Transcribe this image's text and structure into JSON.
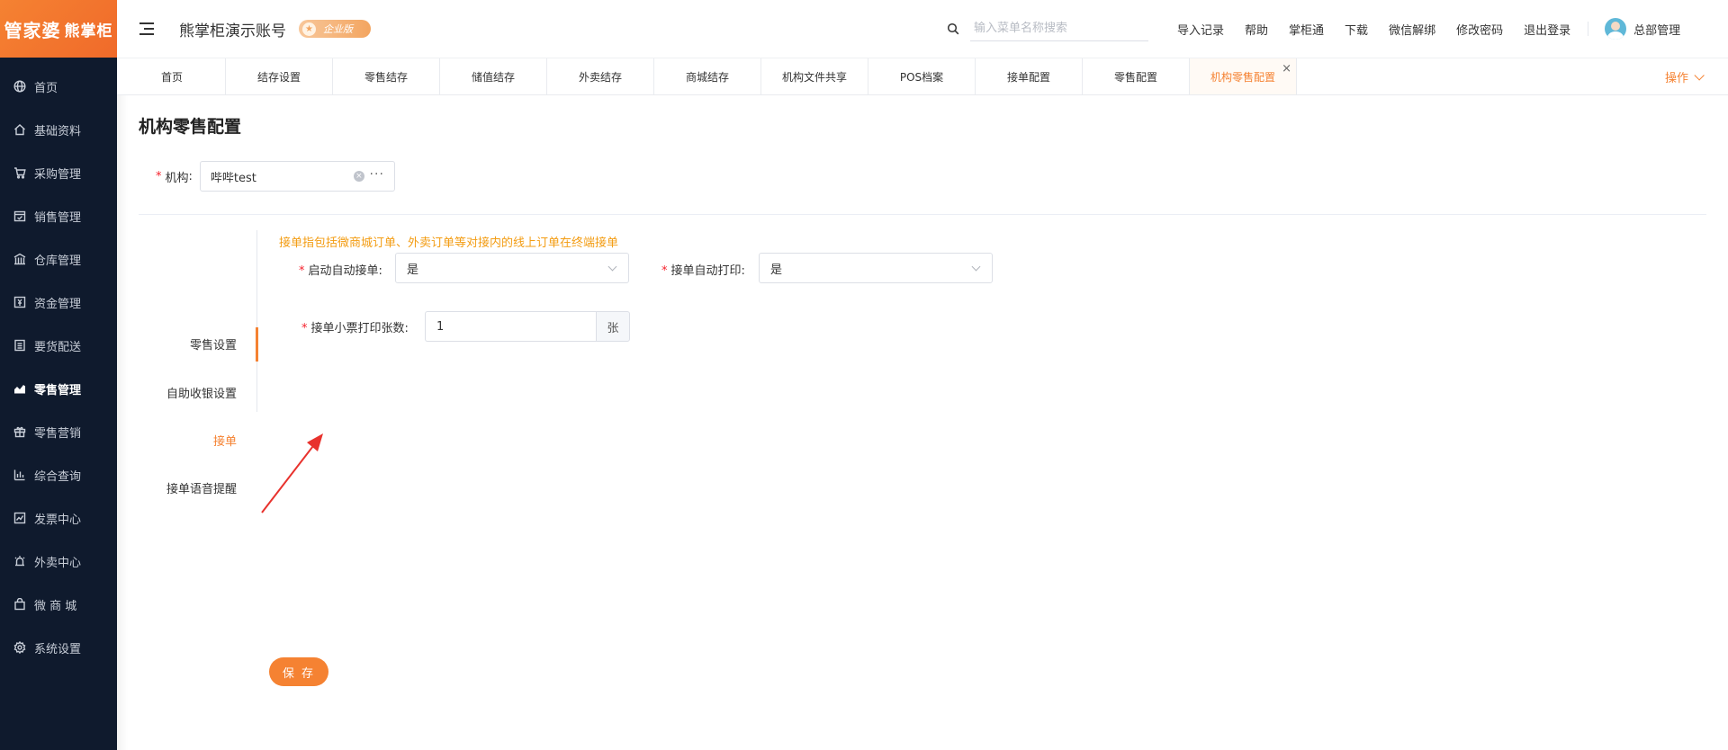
{
  "logo": {
    "part1": "管家婆",
    "part2": "熊掌柜"
  },
  "sidebar": {
    "items": [
      {
        "label": "首页",
        "icon": "globe-icon"
      },
      {
        "label": "基础资料",
        "icon": "home-icon"
      },
      {
        "label": "采购管理",
        "icon": "cart-icon"
      },
      {
        "label": "销售管理",
        "icon": "calendar-icon"
      },
      {
        "label": "仓库管理",
        "icon": "warehouse-icon"
      },
      {
        "label": "资金管理",
        "icon": "money-icon"
      },
      {
        "label": "要货配送",
        "icon": "list-icon"
      },
      {
        "label": "零售管理",
        "icon": "chart-icon",
        "active": true
      },
      {
        "label": "零售营销",
        "icon": "gift-icon"
      },
      {
        "label": "综合查询",
        "icon": "bar-chart-icon"
      },
      {
        "label": "发票中心",
        "icon": "trend-icon"
      },
      {
        "label": "外卖中心",
        "icon": "alarm-icon"
      },
      {
        "label": "微 商 城",
        "icon": "bag-icon"
      },
      {
        "label": "系统设置",
        "icon": "gear-icon"
      }
    ]
  },
  "header": {
    "account_name": "熊掌柜演示账号",
    "edition_badge": "企业版",
    "search_placeholder": "输入菜单名称搜索",
    "links": [
      "导入记录",
      "帮助",
      "掌柜通",
      "下载",
      "微信解绑",
      "修改密码",
      "退出登录"
    ],
    "user_name": "总部管理"
  },
  "tabs": {
    "items": [
      "首页",
      "结存设置",
      "零售结存",
      "储值结存",
      "外卖结存",
      "商城结存",
      "机构文件共享",
      "POS档案",
      "接单配置",
      "零售配置",
      "机构零售配置"
    ],
    "active_index": 10,
    "close_glyph": "×",
    "operations_label": "操作"
  },
  "page": {
    "title": "机构零售配置",
    "org_label": "机构",
    "org_value": "哔哔test",
    "org_more": "···"
  },
  "inner_nav": {
    "items": [
      "零售设置",
      "自助收银设置",
      "接单",
      "接单语音提醒"
    ],
    "active_index": 2
  },
  "form": {
    "hint": "接单指包括微商城订单、外卖订单等对接内的线上订单在终端接单",
    "auto_accept_label": "启动自动接单",
    "auto_accept_value": "是",
    "auto_print_label": "接单自动打印",
    "auto_print_value": "是",
    "print_count_label": "接单小票打印张数",
    "print_count_value": "1",
    "print_count_unit": "张",
    "save_label": "保 存"
  },
  "colors": {
    "accent": "#f58232",
    "sidebar_bg": "#0f1a2d",
    "hint": "#f39c12",
    "annotation_arrow": "#e8322d"
  }
}
